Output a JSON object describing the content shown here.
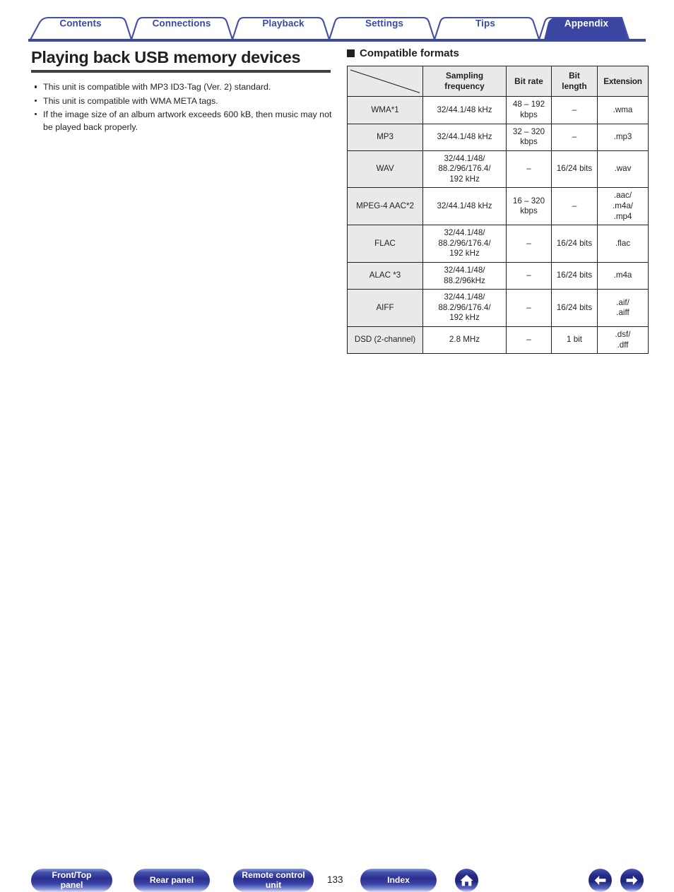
{
  "tabs": [
    {
      "label": "Contents",
      "active": false
    },
    {
      "label": "Connections",
      "active": false
    },
    {
      "label": "Playback",
      "active": false
    },
    {
      "label": "Settings",
      "active": false
    },
    {
      "label": "Tips",
      "active": false
    },
    {
      "label": "Appendix",
      "active": true
    }
  ],
  "page": {
    "title": "Playing back USB memory devices",
    "bullets": [
      "This unit is compatible with MP3 ID3-Tag (Ver. 2) standard.",
      "This unit is compatible with WMA META tags.",
      "If the image size of an album artwork exceeds 600 kB, then music may not be played back properly."
    ],
    "number": "133"
  },
  "section": {
    "heading": "Compatible formats",
    "marker": "filled-square-icon"
  },
  "table": {
    "headers": {
      "corner": "",
      "sampling_frequency": "Sampling\nfrequency",
      "sampling_frequency_line1": "Sampling",
      "sampling_frequency_line2": "frequency",
      "bit_rate": "Bit rate",
      "bit_length_line1": "Bit",
      "bit_length_line2": "length",
      "extension": "Extension"
    },
    "rows": [
      {
        "name": "WMA",
        "name_sup": "*1",
        "sampling_frequency": "32/44.1/48 kHz",
        "bit_rate": "48 – 192\nkbps",
        "bit_length": "–",
        "extension": ".wma"
      },
      {
        "name": "MP3",
        "name_sup": "",
        "sampling_frequency": "32/44.1/48 kHz",
        "bit_rate": "32 – 320\nkbps",
        "bit_length": "–",
        "extension": ".mp3"
      },
      {
        "name": "WAV",
        "name_sup": "",
        "sampling_frequency": "32/44.1/48/\n88.2/96/176.4/\n192 kHz",
        "bit_rate": "–",
        "bit_length": "16/24 bits",
        "extension": ".wav"
      },
      {
        "name": "MPEG-4 AAC",
        "name_sup": "*2",
        "sampling_frequency": "32/44.1/48 kHz",
        "bit_rate": "16 – 320\nkbps",
        "bit_length": "–",
        "extension": ".aac/\n.m4a/\n.mp4"
      },
      {
        "name": "FLAC",
        "name_sup": "",
        "sampling_frequency": "32/44.1/48/\n88.2/96/176.4/\n192 kHz",
        "bit_rate": "–",
        "bit_length": "16/24 bits",
        "extension": ".flac"
      },
      {
        "name": "ALAC ",
        "name_sup": "*3",
        "sampling_frequency": "32/44.1/48/\n88.2/96kHz",
        "bit_rate": "–",
        "bit_length": "16/24 bits",
        "extension": ".m4a"
      },
      {
        "name": "AIFF",
        "name_sup": "",
        "sampling_frequency": "32/44.1/48/\n88.2/96/176.4/\n192 kHz",
        "bit_rate": "–",
        "bit_length": "16/24 bits",
        "extension": ".aif/\n.aiff"
      },
      {
        "name": "DSD (2-channel)",
        "name_sup": "",
        "sampling_frequency": "2.8 MHz",
        "bit_rate": "–",
        "bit_length": "1 bit",
        "extension": ".dsf/\n.dff"
      }
    ]
  },
  "footer": {
    "front_top_panel": "Front/Top\npanel",
    "front_top_panel_line1": "Front/Top",
    "front_top_panel_line2": "panel",
    "rear_panel": "Rear panel",
    "remote_control_unit_line1": "Remote control",
    "remote_control_unit_line2": "unit",
    "index": "Index",
    "home_icon": "home-icon",
    "prev_icon": "arrow-left-icon",
    "next_icon": "arrow-right-icon"
  },
  "colors": {
    "brand_blue": "#3b4aa0",
    "active_tab": "#3a46a2",
    "text": "#231f20",
    "table_header_bg": "#e9e9e9",
    "rule": "#3f3f3f"
  }
}
